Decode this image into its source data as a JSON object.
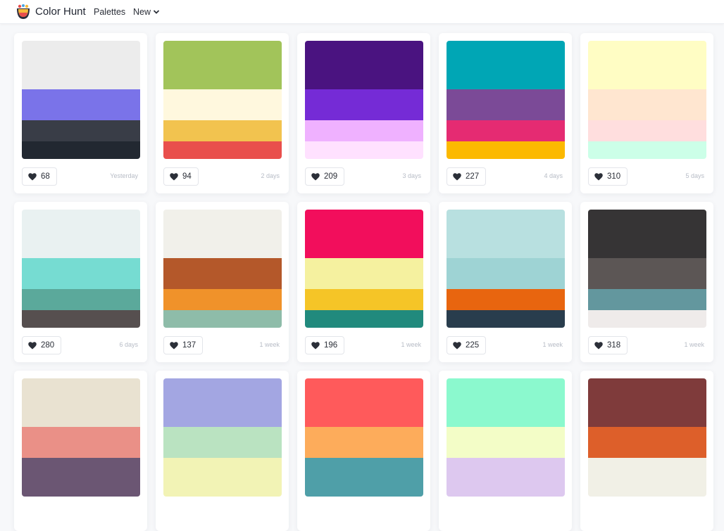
{
  "header": {
    "brand": "Color Hunt",
    "nav": {
      "palettes": "Palettes",
      "new": "New"
    },
    "icons": {
      "logo": "color-hunt-logo-icon",
      "new_dropdown": "chevron-down-icon"
    }
  },
  "palettes": [
    {
      "colors": [
        "#ececec",
        "#7a73e9",
        "#393d47",
        "#222831"
      ],
      "likes": "68",
      "date": "Yesterday"
    },
    {
      "colors": [
        "#a2c45a",
        "#fff8de",
        "#f2c34f",
        "#e94f4c"
      ],
      "likes": "94",
      "date": "2 days"
    },
    {
      "colors": [
        "#4a1380",
        "#752bd6",
        "#efb1ff",
        "#ffe1ff"
      ],
      "likes": "209",
      "date": "3 days"
    },
    {
      "colors": [
        "#00a6b5",
        "#7b4a97",
        "#e52b72",
        "#fcb900"
      ],
      "likes": "227",
      "date": "4 days"
    },
    {
      "colors": [
        "#fffdc4",
        "#ffe6d0",
        "#ffdede",
        "#ccffe8"
      ],
      "likes": "310",
      "date": "5 days"
    },
    {
      "colors": [
        "#e9f1f1",
        "#76dcd2",
        "#5ba99b",
        "#564f4f"
      ],
      "likes": "280",
      "date": "6 days"
    },
    {
      "colors": [
        "#f1f0ea",
        "#b4582a",
        "#f0922a",
        "#8ebca9"
      ],
      "likes": "137",
      "date": "1 week"
    },
    {
      "colors": [
        "#f20e5c",
        "#f5f19f",
        "#f5c527",
        "#218a7d"
      ],
      "likes": "196",
      "date": "1 week"
    },
    {
      "colors": [
        "#b8e0e0",
        "#9ed3d4",
        "#e8650f",
        "#293d4d"
      ],
      "likes": "225",
      "date": "1 week"
    },
    {
      "colors": [
        "#363435",
        "#5c5655",
        "#63979e",
        "#efebea"
      ],
      "likes": "318",
      "date": "1 week"
    },
    {
      "colors": [
        "#e9e2d1",
        "#ea9087",
        "#6b5673",
        "#6b5673"
      ],
      "likes": "",
      "date": ""
    },
    {
      "colors": [
        "#a3a6e2",
        "#bae3c1",
        "#f2f3b5",
        "#f2f3b5"
      ],
      "likes": "",
      "date": ""
    },
    {
      "colors": [
        "#ff5a5b",
        "#fdac5b",
        "#4f9fa8",
        "#4f9fa8"
      ],
      "likes": "",
      "date": ""
    },
    {
      "colors": [
        "#8bf9ce",
        "#f3fdc7",
        "#ddc8ef",
        "#ddc8ef"
      ],
      "likes": "",
      "date": ""
    },
    {
      "colors": [
        "#7f3b3b",
        "#dd5f2a",
        "#f1f0e6",
        "#f1f0e6"
      ],
      "likes": "",
      "date": ""
    }
  ]
}
